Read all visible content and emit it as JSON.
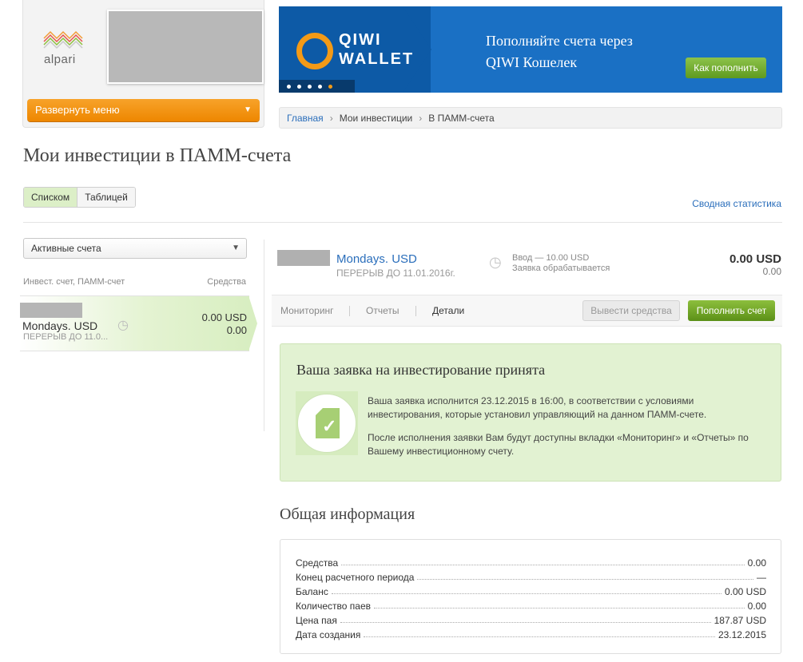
{
  "logo": {
    "text": "alpari"
  },
  "menu": {
    "expand_label": "Развернуть меню"
  },
  "banner": {
    "brand_line1": "QIWI",
    "brand_line2": "WALLET",
    "title_line1": "Пополняйте счета через",
    "title_line2": "QIWI Кошелек",
    "button_label": "Как пополнить"
  },
  "breadcrumb": {
    "items": [
      {
        "label": "Главная"
      },
      {
        "label": "Мои инвестиции"
      },
      {
        "label": "В ПАММ-счета"
      }
    ]
  },
  "page": {
    "title": "Мои инвестиции в ПАММ-счета"
  },
  "view_toggle": {
    "list_label": "Списком",
    "table_label": "Таблицей"
  },
  "summary_link": "Сводная статистика",
  "filter": {
    "selected": "Активные счета"
  },
  "list": {
    "col_account": "Инвест. счет, ПАММ-счет",
    "col_funds": "Средства",
    "items": [
      {
        "name": "Mondays. USD",
        "sub": "ПЕРЕРЫВ ДО 11.0...",
        "amount": "0.00 USD",
        "amount2": "0.00"
      }
    ]
  },
  "account": {
    "name": "Mondays. USD",
    "sub": "ПЕРЕРЫВ ДО 11.01.2016г.",
    "status_line1": "Ввод — 10.00 USD",
    "status_line2": "Заявка обрабатывается",
    "amount": "0.00 USD",
    "amount2": "0.00"
  },
  "tabs": {
    "monitoring": "Мониторинг",
    "reports": "Отчеты",
    "details": "Детали",
    "withdraw": "Вывести средства",
    "topup": "Пополнить счет"
  },
  "notice": {
    "title": "Ваша заявка на инвестирование принята",
    "p1": "Ваша заявка исполнится 23.12.2015 в 16:00, в соответствии с условиями инвестирования, которые установил управляющий на данном ПАММ-счете.",
    "p2": "После исполнения заявки Вам будут доступны вкладки «Мониторинг» и «Отчеты» по Вашему инвестиционному счету."
  },
  "general_info": {
    "title": "Общая информация",
    "rows": [
      {
        "label": "Средства",
        "value": "0.00"
      },
      {
        "label": "Конец расчетного периода",
        "value": "—"
      },
      {
        "label": "Баланс",
        "value": "0.00 USD"
      },
      {
        "label": "Количество паев",
        "value": "0.00"
      },
      {
        "label": "Цена пая",
        "value": "187.87 USD"
      },
      {
        "label": "Дата создания",
        "value": "23.12.2015"
      }
    ]
  },
  "colors": {
    "accent_orange": "#ee8700",
    "link_blue": "#2a6ebb",
    "success_green": "#e2f2d2",
    "button_green": "#5b9017",
    "banner_blue": "#1a70c4"
  }
}
